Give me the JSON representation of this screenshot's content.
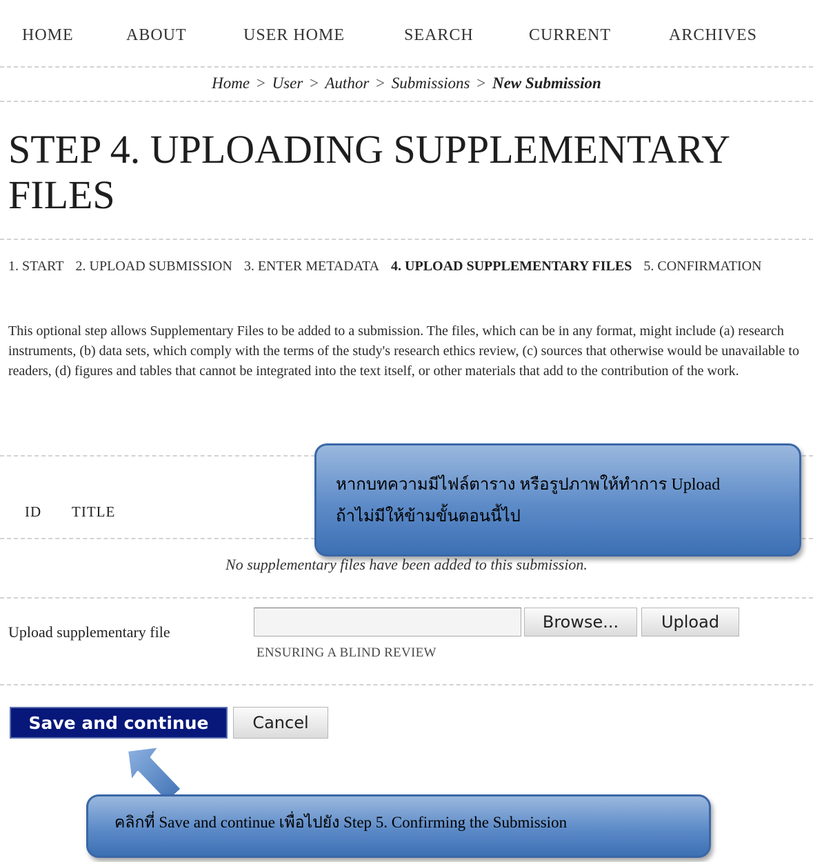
{
  "nav": {
    "items": [
      "HOME",
      "ABOUT",
      "USER HOME",
      "SEARCH",
      "CURRENT",
      "ARCHIVES"
    ]
  },
  "breadcrumb": {
    "items": [
      "Home",
      "User",
      "Author",
      "Submissions"
    ],
    "separator": ">",
    "current": "New Submission"
  },
  "page": {
    "title": "STEP 4. UPLOADING SUPPLEMENTARY FILES"
  },
  "steps": {
    "items": [
      "1. START",
      "2. UPLOAD SUBMISSION",
      "3. ENTER METADATA",
      "4. UPLOAD SUPPLEMENTARY FILES",
      "5. CONFIRMATION"
    ],
    "active": "4. UPLOAD SUPPLEMENTARY FILES"
  },
  "intro": {
    "text": "This optional step allows Supplementary Files to be added to a submission. The files, which can be in any format, might include (a) research instruments, (b) data sets, which comply with the terms of the study's research ethics review, (c) sources that otherwise would be unavailable to readers, (d) figures and tables that cannot be integrated into the text itself, or other materials that add to the contribution of the work."
  },
  "files_table": {
    "columns": [
      "ID",
      "TITLE"
    ],
    "empty_message": "No supplementary files have been added to this submission."
  },
  "upload": {
    "label": "Upload supplementary file",
    "file_value": "",
    "browse_label": "Browse...",
    "upload_label": "Upload",
    "blind_review_link": "ENSURING A BLIND REVIEW"
  },
  "actions": {
    "save_label": "Save and continue",
    "cancel_label": "Cancel"
  },
  "callouts": {
    "upload_tip_line1": "หากบทความมีไฟล์ตาราง หรือรูปภาพให้ทำการ Upload",
    "upload_tip_line2": "ถ้าไม่มีให้ข้ามขั้นตอนนี้ไป",
    "save_tip": "คลิกที่ Save and continue เพื่อไปยัง Step 5. Confirming the Submission"
  },
  "colors": {
    "save_button_bg": "#07177a",
    "callout_blue": "#5d8bc8",
    "arrow_blue": "#4a7bc0"
  },
  "icons": {
    "pointer_arrow": "up-left-arrow-icon"
  }
}
